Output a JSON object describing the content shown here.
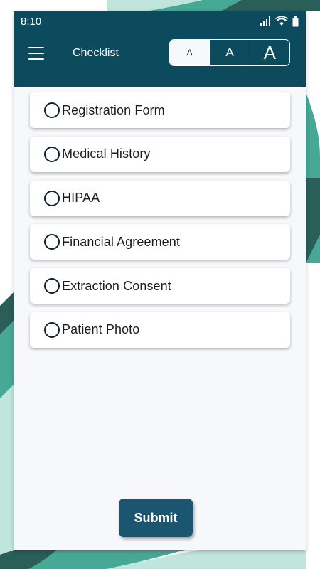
{
  "status_bar": {
    "time": "8:10"
  },
  "header": {
    "title": "Checklist",
    "font_sizes": [
      {
        "label": "A",
        "selected": true
      },
      {
        "label": "A",
        "selected": false
      },
      {
        "label": "A",
        "selected": false
      }
    ]
  },
  "checklist": {
    "items": [
      {
        "label": "Registration Form",
        "checked": false
      },
      {
        "label": "Medical History",
        "checked": false
      },
      {
        "label": "HIPAA",
        "checked": false
      },
      {
        "label": "Financial Agreement",
        "checked": false
      },
      {
        "label": "Extraction Consent",
        "checked": false
      },
      {
        "label": "Patient Photo",
        "checked": false
      }
    ]
  },
  "submit_label": "Submit",
  "colors": {
    "header_bg": "#0c4a5e",
    "submit_bg": "#1b5570",
    "background_teal": "#48a896",
    "background_dark": "#2a5e58",
    "background_mint": "#bfe5dc"
  }
}
